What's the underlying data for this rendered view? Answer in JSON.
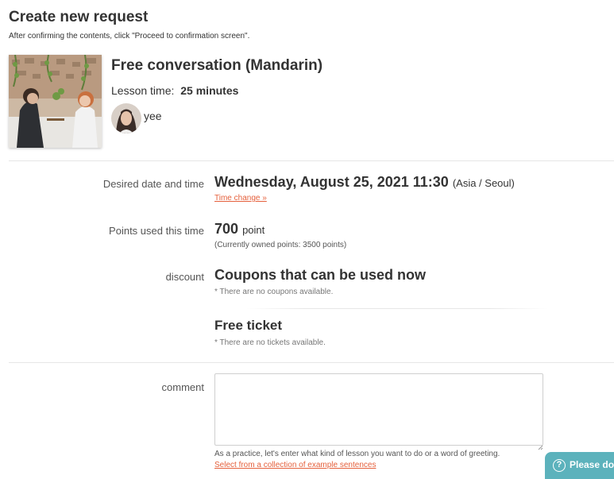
{
  "header": {
    "title": "Create new request",
    "subtitle": "After confirming the contents, click \"Proceed to confirmation screen\"."
  },
  "lesson": {
    "title": "Free conversation (Mandarin)",
    "time_label": "Lesson time:",
    "time_value": "25 minutes",
    "teacher_name": "yee"
  },
  "date_row": {
    "label": "Desired date and time",
    "value": "Wednesday, August 25, 2021 11:30",
    "timezone": "(Asia / Seoul)",
    "change_link": "Time change »"
  },
  "points_row": {
    "label": "Points used this time",
    "value": "700",
    "unit": "point",
    "owned": "(Currently owned points: 3500 points)"
  },
  "discount_row": {
    "label": "discount",
    "coupons_title": "Coupons that can be used now",
    "coupons_note": "* There are no coupons available.",
    "ticket_title": "Free ticket",
    "ticket_note": "* There are no tickets available."
  },
  "comment_row": {
    "label": "comment",
    "value": "",
    "hint": "As a practice, let's enter what kind of lesson you want to do or a word of greeting.",
    "examples_link": "Select from a collection of example sentences"
  },
  "help": {
    "label": "Please do"
  },
  "colors": {
    "link": "#e5603c",
    "help_button": "#5cb2bc"
  }
}
